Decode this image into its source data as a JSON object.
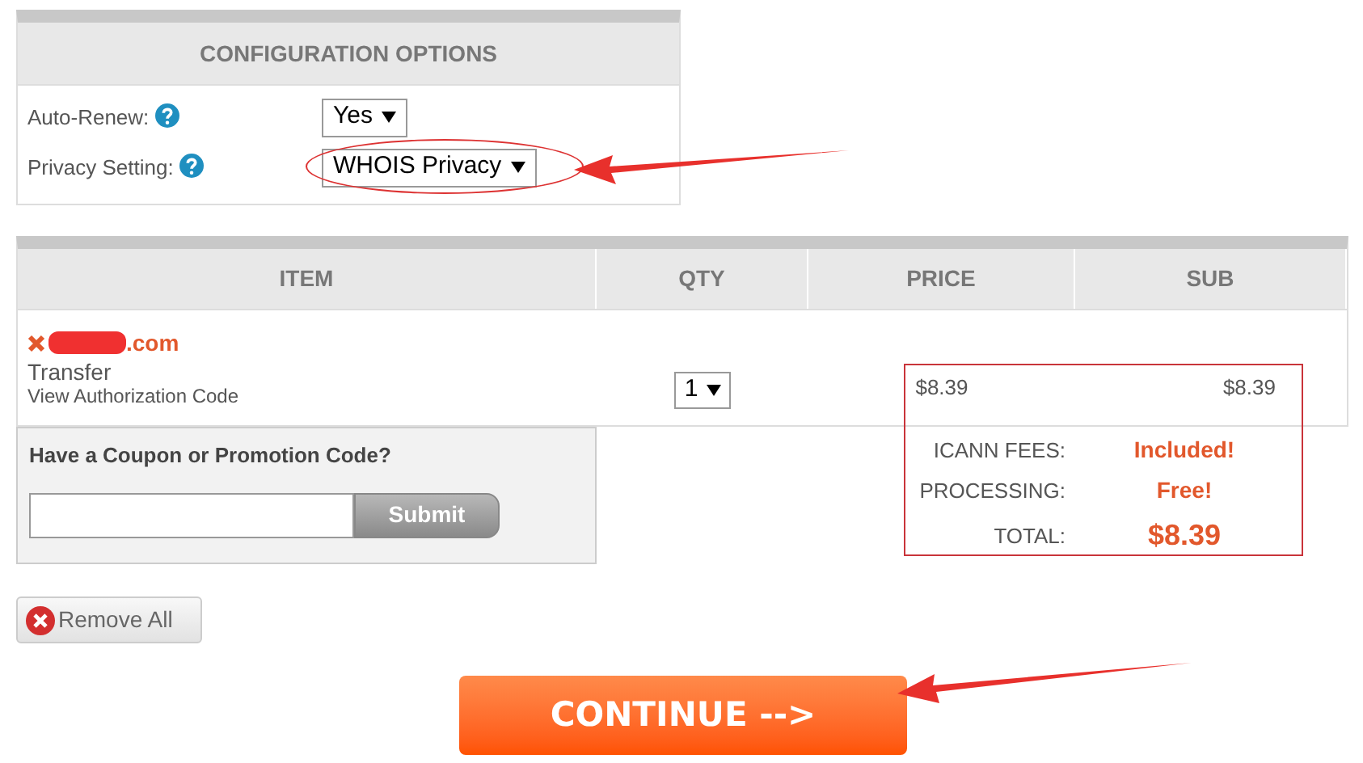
{
  "config": {
    "title": "CONFIGURATION OPTIONS",
    "rows": [
      {
        "label": "Auto-Renew:",
        "value": "Yes",
        "highlighted": false
      },
      {
        "label": "Privacy Setting:",
        "value": "WHOIS Privacy",
        "highlighted": true
      }
    ]
  },
  "cart": {
    "columns": [
      "ITEM",
      "QTY",
      "PRICE",
      "SUB"
    ],
    "items": [
      {
        "domain": ".com",
        "type": "Transfer",
        "link": "View Authorization Code",
        "qty": "1",
        "price": "$8.39",
        "sub": "$8.39"
      }
    ]
  },
  "coupon": {
    "title": "Have a Coupon or Promotion Code?",
    "button": "Submit"
  },
  "totals": [
    {
      "label": "ICANN FEES:",
      "value": "Included!",
      "kind": "fee"
    },
    {
      "label": "PROCESSING:",
      "value": "Free!",
      "kind": "fee"
    },
    {
      "label": "TOTAL:",
      "value": "$8.39",
      "kind": "total"
    }
  ],
  "remove_all": "Remove All",
  "continue": "CONTINUE -->"
}
